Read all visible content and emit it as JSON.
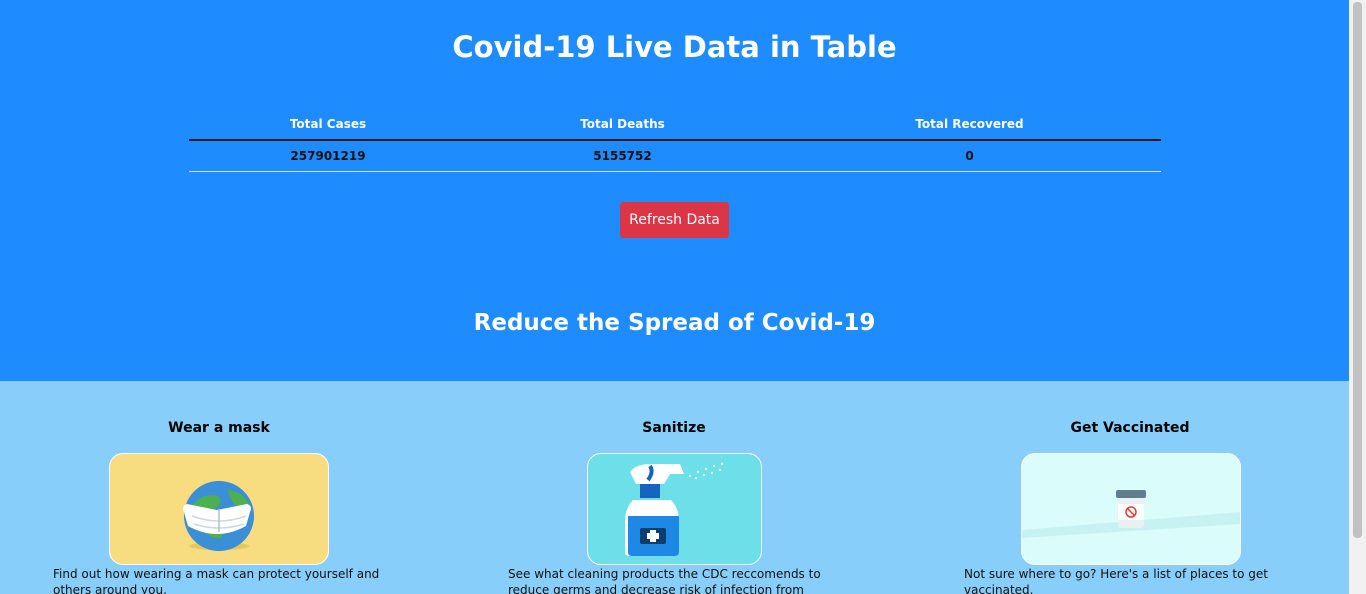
{
  "header": {
    "title": "Covid-19 Live Data in Table"
  },
  "stats_table": {
    "headers": [
      "Total Cases",
      "Total Deaths",
      "Total Recovered"
    ],
    "row": [
      "257901219",
      "5155752",
      "0"
    ]
  },
  "refresh_button": {
    "label": "Refresh Data"
  },
  "section": {
    "title": "Reduce the Spread of Covid-19"
  },
  "cards": [
    {
      "title": "Wear a mask",
      "text": "Find out how wearing a mask can protect yourself and others around you."
    },
    {
      "title": "Sanitize",
      "text": "See what cleaning products the CDC reccomends to reduce germs and decrease risk of infection from surfaces."
    },
    {
      "title": "Get Vaccinated",
      "text": "Not sure where to go? Here's a list of places to get vaccinated."
    }
  ],
  "colors": {
    "hero_bg": "#1e8cff",
    "section_bg": "#87cefa",
    "refresh_button": "#dc3545",
    "mask_card_bg": "#f7dd80",
    "sanitize_card_bg": "#6ddfe8",
    "vaccine_card_bg": "#dafcfb"
  },
  "icons": [
    "globe-mask-icon",
    "spray-bottle-icon",
    "vaccine-vial-icon"
  ]
}
